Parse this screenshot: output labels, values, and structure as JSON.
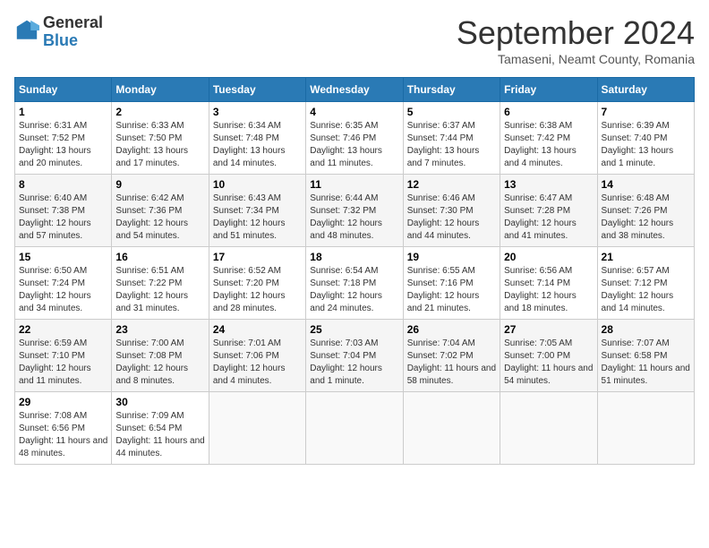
{
  "logo": {
    "general": "General",
    "blue": "Blue"
  },
  "title": "September 2024",
  "subtitle": "Tamaseni, Neamt County, Romania",
  "weekdays": [
    "Sunday",
    "Monday",
    "Tuesday",
    "Wednesday",
    "Thursday",
    "Friday",
    "Saturday"
  ],
  "weeks": [
    [
      {
        "day": "1",
        "sunrise": "6:31 AM",
        "sunset": "7:52 PM",
        "daylight": "13 hours and 20 minutes."
      },
      {
        "day": "2",
        "sunrise": "6:33 AM",
        "sunset": "7:50 PM",
        "daylight": "13 hours and 17 minutes."
      },
      {
        "day": "3",
        "sunrise": "6:34 AM",
        "sunset": "7:48 PM",
        "daylight": "13 hours and 14 minutes."
      },
      {
        "day": "4",
        "sunrise": "6:35 AM",
        "sunset": "7:46 PM",
        "daylight": "13 hours and 11 minutes."
      },
      {
        "day": "5",
        "sunrise": "6:37 AM",
        "sunset": "7:44 PM",
        "daylight": "13 hours and 7 minutes."
      },
      {
        "day": "6",
        "sunrise": "6:38 AM",
        "sunset": "7:42 PM",
        "daylight": "13 hours and 4 minutes."
      },
      {
        "day": "7",
        "sunrise": "6:39 AM",
        "sunset": "7:40 PM",
        "daylight": "13 hours and 1 minute."
      }
    ],
    [
      {
        "day": "8",
        "sunrise": "6:40 AM",
        "sunset": "7:38 PM",
        "daylight": "12 hours and 57 minutes."
      },
      {
        "day": "9",
        "sunrise": "6:42 AM",
        "sunset": "7:36 PM",
        "daylight": "12 hours and 54 minutes."
      },
      {
        "day": "10",
        "sunrise": "6:43 AM",
        "sunset": "7:34 PM",
        "daylight": "12 hours and 51 minutes."
      },
      {
        "day": "11",
        "sunrise": "6:44 AM",
        "sunset": "7:32 PM",
        "daylight": "12 hours and 48 minutes."
      },
      {
        "day": "12",
        "sunrise": "6:46 AM",
        "sunset": "7:30 PM",
        "daylight": "12 hours and 44 minutes."
      },
      {
        "day": "13",
        "sunrise": "6:47 AM",
        "sunset": "7:28 PM",
        "daylight": "12 hours and 41 minutes."
      },
      {
        "day": "14",
        "sunrise": "6:48 AM",
        "sunset": "7:26 PM",
        "daylight": "12 hours and 38 minutes."
      }
    ],
    [
      {
        "day": "15",
        "sunrise": "6:50 AM",
        "sunset": "7:24 PM",
        "daylight": "12 hours and 34 minutes."
      },
      {
        "day": "16",
        "sunrise": "6:51 AM",
        "sunset": "7:22 PM",
        "daylight": "12 hours and 31 minutes."
      },
      {
        "day": "17",
        "sunrise": "6:52 AM",
        "sunset": "7:20 PM",
        "daylight": "12 hours and 28 minutes."
      },
      {
        "day": "18",
        "sunrise": "6:54 AM",
        "sunset": "7:18 PM",
        "daylight": "12 hours and 24 minutes."
      },
      {
        "day": "19",
        "sunrise": "6:55 AM",
        "sunset": "7:16 PM",
        "daylight": "12 hours and 21 minutes."
      },
      {
        "day": "20",
        "sunrise": "6:56 AM",
        "sunset": "7:14 PM",
        "daylight": "12 hours and 18 minutes."
      },
      {
        "day": "21",
        "sunrise": "6:57 AM",
        "sunset": "7:12 PM",
        "daylight": "12 hours and 14 minutes."
      }
    ],
    [
      {
        "day": "22",
        "sunrise": "6:59 AM",
        "sunset": "7:10 PM",
        "daylight": "12 hours and 11 minutes."
      },
      {
        "day": "23",
        "sunrise": "7:00 AM",
        "sunset": "7:08 PM",
        "daylight": "12 hours and 8 minutes."
      },
      {
        "day": "24",
        "sunrise": "7:01 AM",
        "sunset": "7:06 PM",
        "daylight": "12 hours and 4 minutes."
      },
      {
        "day": "25",
        "sunrise": "7:03 AM",
        "sunset": "7:04 PM",
        "daylight": "12 hours and 1 minute."
      },
      {
        "day": "26",
        "sunrise": "7:04 AM",
        "sunset": "7:02 PM",
        "daylight": "11 hours and 58 minutes."
      },
      {
        "day": "27",
        "sunrise": "7:05 AM",
        "sunset": "7:00 PM",
        "daylight": "11 hours and 54 minutes."
      },
      {
        "day": "28",
        "sunrise": "7:07 AM",
        "sunset": "6:58 PM",
        "daylight": "11 hours and 51 minutes."
      }
    ],
    [
      {
        "day": "29",
        "sunrise": "7:08 AM",
        "sunset": "6:56 PM",
        "daylight": "11 hours and 48 minutes."
      },
      {
        "day": "30",
        "sunrise": "7:09 AM",
        "sunset": "6:54 PM",
        "daylight": "11 hours and 44 minutes."
      },
      null,
      null,
      null,
      null,
      null
    ]
  ],
  "labels": {
    "sunrise": "Sunrise:",
    "sunset": "Sunset:",
    "daylight": "Daylight:"
  }
}
